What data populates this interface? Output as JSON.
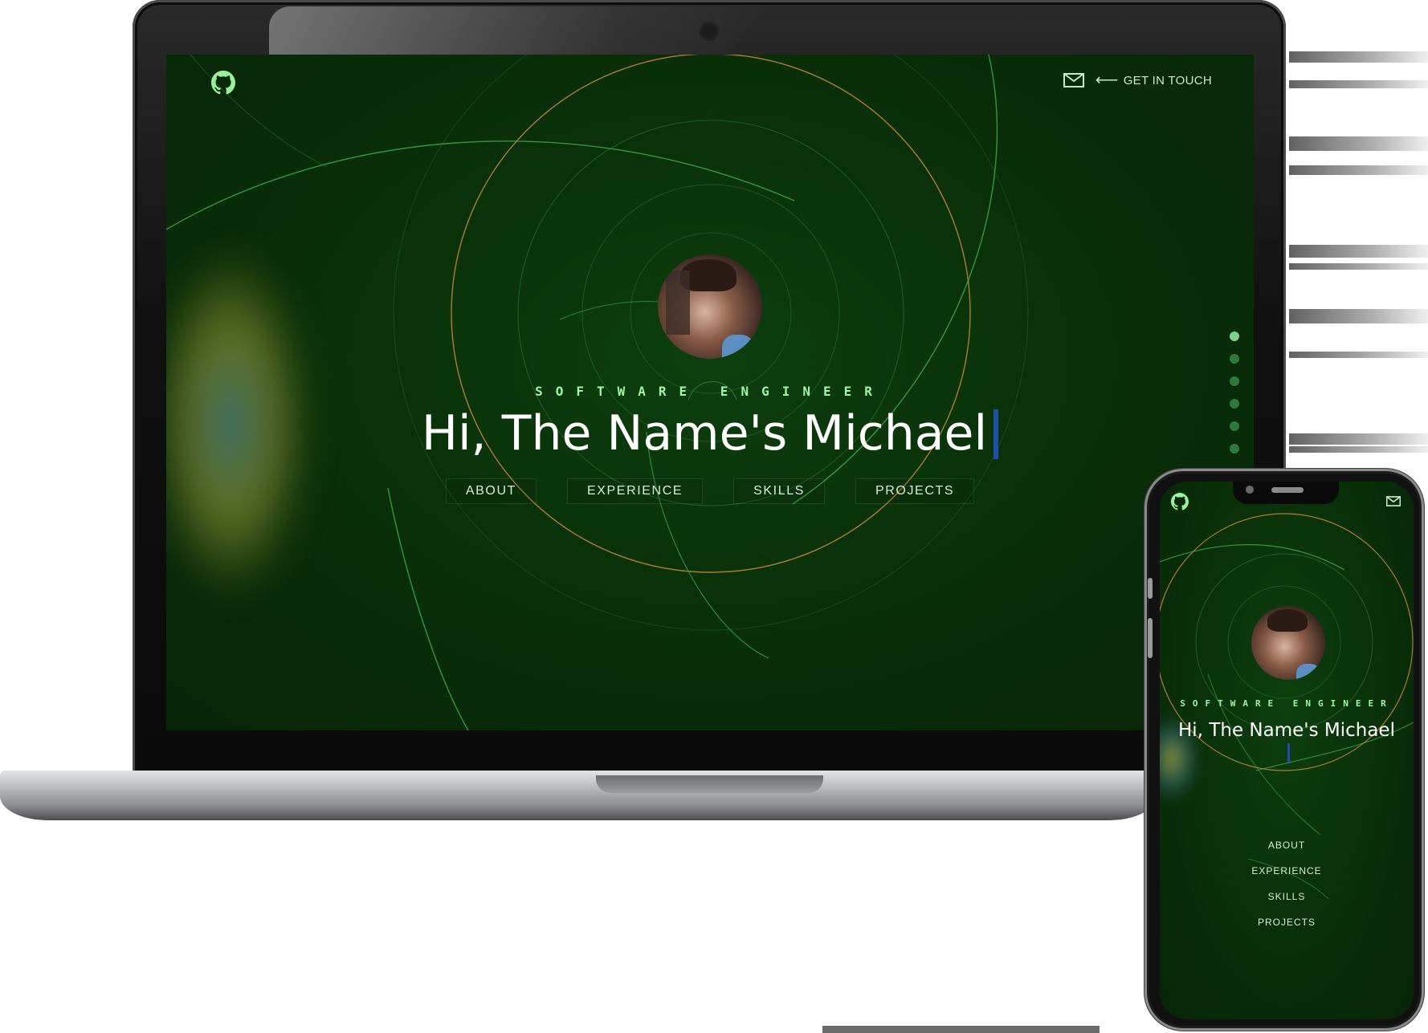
{
  "desktop": {
    "header": {
      "github_icon": "github-icon",
      "mail_icon": "mail-icon",
      "arrow_icon": "arrow-left-icon",
      "contact_label": "GET IN TOUCH"
    },
    "hero": {
      "role": "SOFTWARE ENGINEER",
      "headline": "Hi, The Name's Michael"
    },
    "nav": {
      "items": [
        {
          "label": "ABOUT"
        },
        {
          "label": "EXPERIENCE"
        },
        {
          "label": "SKILLS"
        },
        {
          "label": "PROJECTS"
        }
      ]
    },
    "section_dots": {
      "count": 6,
      "active_index": 0
    }
  },
  "mobile": {
    "header": {
      "github_icon": "github-icon",
      "mail_icon": "mail-icon"
    },
    "hero": {
      "role": "SOFTWARE ENGINEER",
      "headline": "Hi, The Name's Michael"
    },
    "nav": {
      "items": [
        {
          "label": "ABOUT"
        },
        {
          "label": "EXPERIENCE"
        },
        {
          "label": "SKILLS"
        },
        {
          "label": "PROJECTS"
        }
      ]
    }
  },
  "colors": {
    "background": "#0a3209",
    "accent_green": "#9ef5a6",
    "orbit_orange": "#d08a2e",
    "cursor_blue": "#1d4fae",
    "text_white": "#ffffff"
  }
}
